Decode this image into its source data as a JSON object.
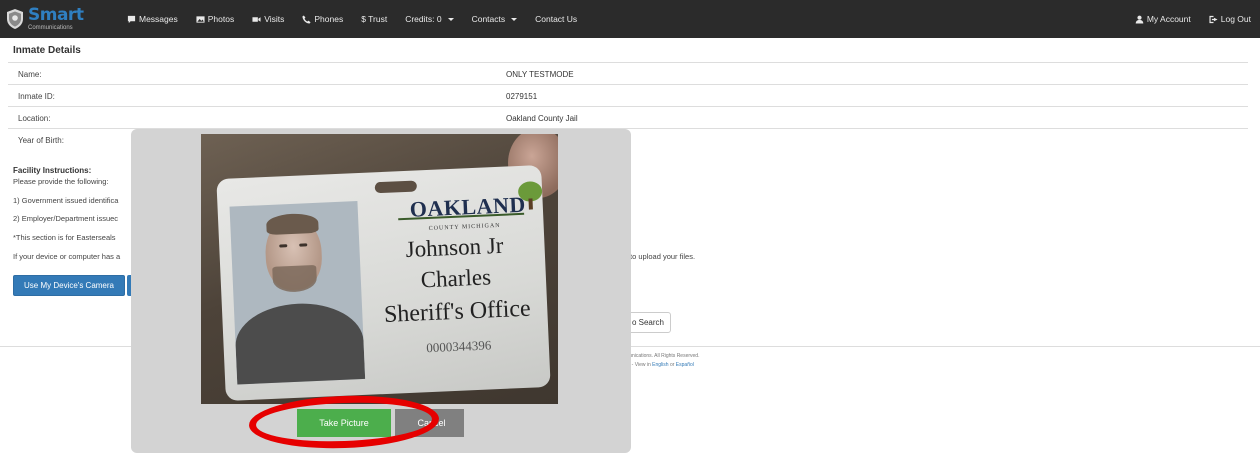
{
  "brand": {
    "name": "Smart",
    "sub": "Communications"
  },
  "nav": {
    "items": [
      {
        "label": "Messages",
        "icon": "comment-icon"
      },
      {
        "label": "Photos",
        "icon": "image-icon"
      },
      {
        "label": "Visits",
        "icon": "video-icon"
      },
      {
        "label": "Phones",
        "icon": "phone-icon"
      },
      {
        "label": "$ Trust",
        "icon": ""
      },
      {
        "label": "Credits: 0",
        "icon": ""
      },
      {
        "label": "Contacts",
        "icon": ""
      },
      {
        "label": "Contact Us",
        "icon": ""
      }
    ],
    "my_account": "My Account",
    "log_out": "Log Out"
  },
  "page": {
    "title": "Inmate Details",
    "rows": [
      {
        "label": "Name:",
        "value": "ONLY TESTMODE"
      },
      {
        "label": "Inmate ID:",
        "value": "0279151"
      },
      {
        "label": "Location:",
        "value": "Oakland County Jail"
      },
      {
        "label": "Year of Birth:",
        "value": ""
      }
    ]
  },
  "facility": {
    "title": "Facility Instructions:",
    "lines": [
      "Please provide the following:",
      "1) Government issued identifica",
      "2) Employer/Department issuec",
      "*This section is for Easterseals",
      "If your device or computer has a"
    ],
    "upload_tail": "to upload your files."
  },
  "buttons": {
    "camera": "Use My Device's Camera",
    "search": "o Search"
  },
  "footer": {
    "line1": "munications. All Rights Reserved.",
    "line2_prefix": "ce - View in ",
    "english": "English",
    "or": " or ",
    "espanol": "Español"
  },
  "modal": {
    "card": {
      "org": "OAKLAND",
      "county": "COUNTY MICHIGAN",
      "last_name": "Johnson Jr",
      "first_name": "Charles",
      "office": "Sheriff's Office",
      "number": "0000344396"
    },
    "take_picture": "Take Picture",
    "cancel": "Cancel"
  },
  "colors": {
    "navbar": "#2b2b2b",
    "primary": "#337ab7",
    "success": "#4cae4c",
    "highlight": "#e60000"
  }
}
